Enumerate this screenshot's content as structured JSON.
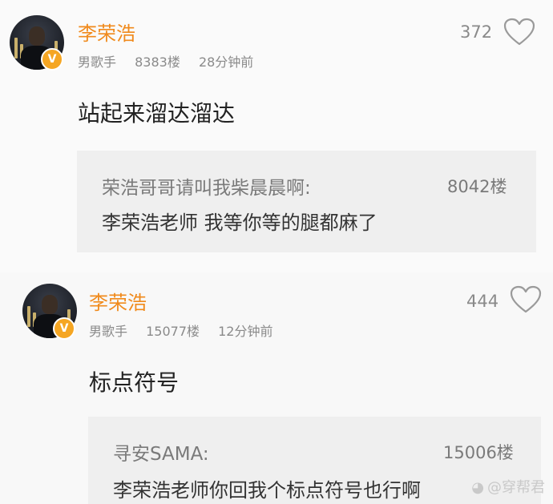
{
  "comments": [
    {
      "user": "李荣浩",
      "badge": "V",
      "title": "男歌手",
      "floor": "8383楼",
      "time": "28分钟前",
      "likes": "372",
      "text": "站起来溜达溜达",
      "reply": {
        "user": "荣浩哥哥请叫我柴晨晨啊:",
        "floor": "8042楼",
        "text": "李荣浩老师  我等你等的腿都麻了"
      }
    },
    {
      "user": "李荣浩",
      "badge": "V",
      "title": "男歌手",
      "floor": "15077楼",
      "time": "12分钟前",
      "likes": "444",
      "text": "标点符号",
      "reply": {
        "user": "寻安SAMA:",
        "floor": "15006楼",
        "text": "李荣浩老师你回我个标点符号也行啊"
      }
    }
  ],
  "watermark": {
    "text": "@穿帮君",
    "icon": "weibo-icon"
  },
  "colors": {
    "username": "#f08a1c",
    "verified_badge": "#f5a623",
    "meta": "#8a8a8a",
    "reply_bg": "#efefef"
  }
}
